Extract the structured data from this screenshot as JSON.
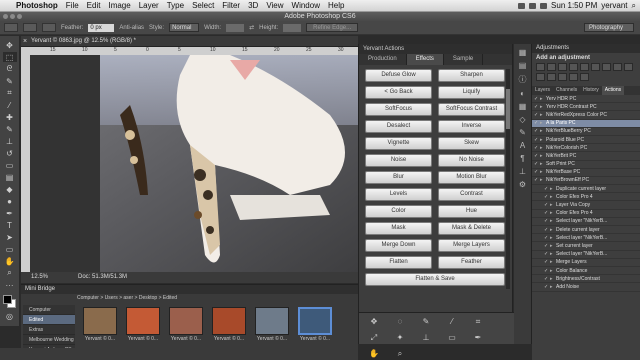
{
  "menubar": {
    "apple": "",
    "app": "Photoshop",
    "items": [
      "File",
      "Edit",
      "Image",
      "Layer",
      "Type",
      "Select",
      "Filter",
      "3D",
      "View",
      "Window",
      "Help"
    ],
    "clock": "Sun 1:50 PM",
    "user": "yervant"
  },
  "window": {
    "title": "Adobe Photoshop CS6"
  },
  "options": {
    "feather_label": "Feather:",
    "feather_value": "0 px",
    "antialias": "Anti-alias",
    "style_label": "Style:",
    "style_value": "Normal",
    "width_label": "Width:",
    "height_label": "Height:",
    "refine_edge": "Refine Edge...",
    "workspace": "Photography"
  },
  "document": {
    "tab_title": "Yervant © 0863.jpg @ 12.5% (RGB/8) *",
    "ruler_marks": [
      "15",
      "10",
      "5",
      "0",
      "5",
      "10",
      "15",
      "20",
      "25",
      "30"
    ],
    "zoom": "12.5%",
    "doc_size": "Doc: 51.3M/51.3M"
  },
  "actions_panel": {
    "title": "Yervant Actions",
    "tabs": [
      "Production",
      "Effects",
      "Sample"
    ],
    "active_tab": "Effects",
    "buttons": [
      [
        "Defuse Glow",
        "Sharpen"
      ],
      [
        "< Go Back",
        "Liquify"
      ],
      [
        "SoftFocus",
        "SoftFocus Contrast"
      ],
      [
        "Desalect",
        "Inverse"
      ],
      [
        "Vignette",
        "Skew"
      ],
      [
        "Noise",
        "No Noise"
      ],
      [
        "Blur",
        "Motion Blur"
      ],
      [
        "Levels",
        "Contrast"
      ],
      [
        "Color",
        "Hue"
      ],
      [
        "Mask",
        "Mask & Delete"
      ],
      [
        "Merge Down",
        "Merge Layers"
      ],
      [
        "Flatten",
        "Feather"
      ]
    ],
    "wide_button": "Flatten & Save",
    "footer_icons": [
      "move-icon",
      "lasso-icon",
      "brush-icon",
      "eyedropper-icon",
      "crop-icon",
      "transform-icon",
      "wand-icon",
      "stamp-icon",
      "eraser-icon",
      "pen-icon",
      "hand-icon",
      "zoom-icon"
    ]
  },
  "mini_bridge": {
    "title": "Mini Bridge",
    "breadcrumb": "Computer  >  Users  >  aser  >  Desktop  >  Edited",
    "side_items": [
      "Computer",
      "Edited",
      "Extras",
      "Melbourne Wedding",
      "Yervant Actions CS"
    ],
    "side_selected": "Edited",
    "thumbs": [
      {
        "caption": "Yervant © 0...",
        "color": "#8a6b4c"
      },
      {
        "caption": "Yervant © 0...",
        "color": "#c45a35"
      },
      {
        "caption": "Yervant © 0...",
        "color": "#9b5f4c"
      },
      {
        "caption": "Yervant © 0...",
        "color": "#a84a2a"
      },
      {
        "caption": "Yervant © 0...",
        "color": "#6e7b8a"
      },
      {
        "caption": "Yervant © 0...",
        "color": "#3e5a7a"
      }
    ],
    "selected_thumb": 5
  },
  "right_panel": {
    "title": "Adjustments",
    "add_label": "Add an adjustment",
    "tabs": [
      "Layers",
      "Channels",
      "History",
      "Actions"
    ],
    "active_tab": "Actions",
    "actions": [
      {
        "label": "Yerv HDR PC",
        "sub": false,
        "sel": false
      },
      {
        "label": "Yerv HDR Contrast PC",
        "sub": false,
        "sel": false
      },
      {
        "label": "NikYerRedXpress Color PC",
        "sub": false,
        "sel": false
      },
      {
        "label": "A la Paris PC",
        "sub": false,
        "sel": true
      },
      {
        "label": "NikYerBlueBerry PC",
        "sub": false,
        "sel": false
      },
      {
        "label": "Polaroid Blue PC",
        "sub": false,
        "sel": false
      },
      {
        "label": "NikYerColorish PC",
        "sub": false,
        "sel": false
      },
      {
        "label": "NikYerBrit PC",
        "sub": false,
        "sel": false
      },
      {
        "label": "Soft Print PC",
        "sub": false,
        "sel": false
      },
      {
        "label": "NikYerBase PC",
        "sub": false,
        "sel": false
      },
      {
        "label": "NikYerBrownEff PC",
        "sub": false,
        "sel": false
      },
      {
        "label": "Duplicate current layer",
        "sub": true,
        "sel": false
      },
      {
        "label": "Color Efex Pro 4",
        "sub": true,
        "sel": false
      },
      {
        "label": "Layer Via Copy",
        "sub": true,
        "sel": false
      },
      {
        "label": "Color Efex Pro 4",
        "sub": true,
        "sel": false
      },
      {
        "label": "Select layer \"NikYerB...",
        "sub": true,
        "sel": false
      },
      {
        "label": "Delete current layer",
        "sub": true,
        "sel": false
      },
      {
        "label": "Select layer \"NikYerB...",
        "sub": true,
        "sel": false
      },
      {
        "label": "Set current layer",
        "sub": true,
        "sel": false
      },
      {
        "label": "Select layer \"NikYerB...",
        "sub": true,
        "sel": false
      },
      {
        "label": "Merge Layers",
        "sub": true,
        "sel": false
      },
      {
        "label": "Color Balance",
        "sub": true,
        "sel": false
      },
      {
        "label": "Brightness/Contrast",
        "sub": true,
        "sel": false
      },
      {
        "label": "Add Noise",
        "sub": true,
        "sel": false
      }
    ]
  },
  "colors": {
    "accent": "#5d8ed6",
    "selection": "#7e8ca5",
    "panel": "#3d3d3d"
  }
}
